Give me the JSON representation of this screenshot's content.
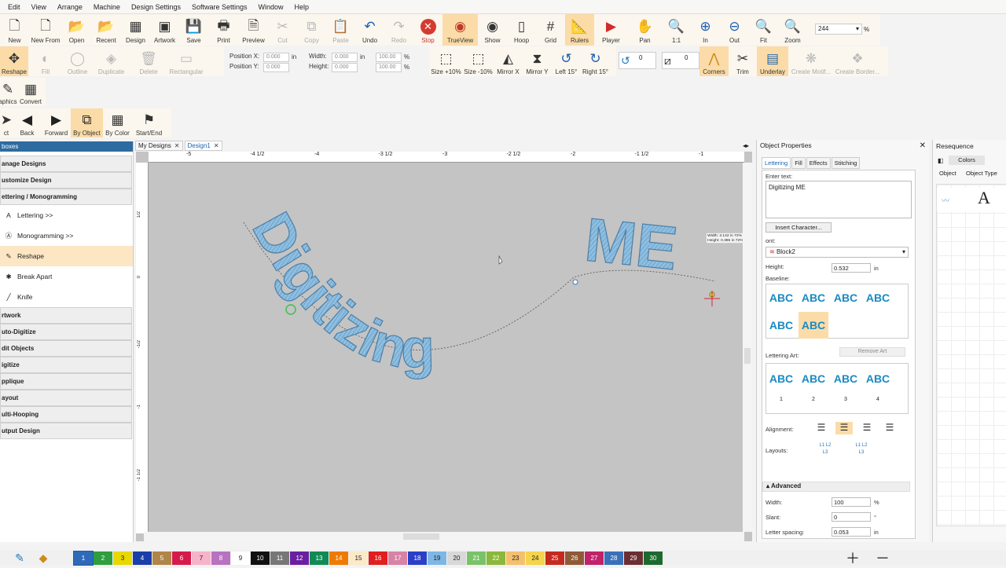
{
  "menu": [
    "Edit",
    "View",
    "Arrange",
    "Machine",
    "Design Settings",
    "Software Settings",
    "Window",
    "Help"
  ],
  "toolbar1": [
    {
      "label": "New",
      "icon": "new-file-icon",
      "state": "normal"
    },
    {
      "label": "New From",
      "icon": "new-from-icon",
      "state": "normal"
    },
    {
      "label": "Open",
      "icon": "open-folder-icon",
      "state": "normal"
    },
    {
      "label": "Recent",
      "icon": "recent-folder-icon",
      "state": "normal"
    },
    {
      "label": "Design",
      "icon": "design-icon",
      "state": "normal"
    },
    {
      "label": "Artwork",
      "icon": "artwork-icon",
      "state": "normal"
    },
    {
      "label": "Save",
      "icon": "save-icon",
      "state": "normal"
    },
    {
      "label": "Print",
      "icon": "print-icon",
      "state": "normal"
    },
    {
      "label": "Preview",
      "icon": "preview-icon",
      "state": "normal"
    },
    {
      "label": "Cut",
      "icon": "cut-icon",
      "state": "disabled"
    },
    {
      "label": "Copy",
      "icon": "copy-icon",
      "state": "disabled"
    },
    {
      "label": "Paste",
      "icon": "paste-icon",
      "state": "disabled"
    },
    {
      "label": "Undo",
      "icon": "undo-icon",
      "state": "normal"
    },
    {
      "label": "Redo",
      "icon": "redo-icon",
      "state": "disabled"
    },
    {
      "label": "Stop",
      "icon": "stop-icon",
      "state": "stop"
    },
    {
      "label": "TrueView",
      "icon": "trueview-eye-icon",
      "state": "selected"
    },
    {
      "label": "Show",
      "icon": "show-eye-icon",
      "state": "normal"
    },
    {
      "label": "Hoop",
      "icon": "hoop-icon",
      "state": "normal"
    },
    {
      "label": "Grid",
      "icon": "grid-icon",
      "state": "normal"
    },
    {
      "label": "Rulers",
      "icon": "rulers-icon",
      "state": "selected"
    },
    {
      "label": "Player",
      "icon": "player-icon",
      "state": "normal"
    },
    {
      "label": "Pan",
      "icon": "pan-hand-icon",
      "state": "normal"
    },
    {
      "label": "1:1",
      "icon": "zoom-1to1-icon",
      "state": "normal"
    },
    {
      "label": "In",
      "icon": "zoom-in-icon",
      "state": "normal"
    },
    {
      "label": "Out",
      "icon": "zoom-out-icon",
      "state": "normal"
    },
    {
      "label": "Fit",
      "icon": "zoom-fit-icon",
      "state": "normal"
    },
    {
      "label": "Zoom",
      "icon": "zoom-icon",
      "state": "normal"
    }
  ],
  "zoom": {
    "value": "244",
    "unit": "%"
  },
  "toolbar2": [
    {
      "label": "Reshape",
      "icon": "reshape-icon",
      "state": "selected"
    },
    {
      "label": "Fill",
      "icon": "fill-icon",
      "state": "disabled"
    },
    {
      "label": "Outline",
      "icon": "outline-icon",
      "state": "disabled"
    },
    {
      "label": "Duplicate",
      "icon": "duplicate-icon",
      "state": "disabled"
    },
    {
      "label": "Delete",
      "icon": "delete-icon",
      "state": "disabled"
    },
    {
      "label": "Rectangular",
      "icon": "rectangular-icon",
      "state": "disabled"
    }
  ],
  "position": {
    "x_label": "Position X:",
    "y_label": "Position Y:",
    "x": "0.000",
    "y": "0.000",
    "unit": "in"
  },
  "size": {
    "w_label": "Width:",
    "h_label": "Height:",
    "w": "0.000",
    "h": "0.000",
    "unit": "in",
    "w_pct": "100.00",
    "h_pct": "100.00",
    "pct": "%"
  },
  "toolbar2b": [
    {
      "label": "Size +10%",
      "icon": "size-up-icon"
    },
    {
      "label": "Size -10%",
      "icon": "size-down-icon"
    },
    {
      "label": "Mirror X",
      "icon": "mirror-x-icon"
    },
    {
      "label": "Mirror Y",
      "icon": "mirror-y-icon"
    },
    {
      "label": "Left 15°",
      "icon": "rotate-left-icon"
    },
    {
      "label": "Right 15°",
      "icon": "rotate-right-icon"
    }
  ],
  "rotate_value": "0",
  "skew_value": "0",
  "toolbar2c": [
    {
      "label": "Corners",
      "icon": "corners-icon",
      "state": "selected"
    },
    {
      "label": "Trim",
      "icon": "trim-icon",
      "state": "normal"
    },
    {
      "label": "Underlay",
      "icon": "underlay-icon",
      "state": "selected"
    },
    {
      "label": "Create Motif...",
      "icon": "motif-icon",
      "state": "disabled"
    },
    {
      "label": "Create Border...",
      "icon": "border-icon",
      "state": "disabled"
    }
  ],
  "toolbar3": [
    {
      "label": "aphics",
      "icon": "graphics-icon"
    },
    {
      "label": "Convert",
      "icon": "convert-icon"
    }
  ],
  "toolbar4": [
    {
      "label": "ct",
      "icon": "select-icon",
      "state": "normal"
    },
    {
      "label": "Back",
      "icon": "back-arrow-icon",
      "state": "normal"
    },
    {
      "label": "Forward",
      "icon": "forward-arrow-icon",
      "state": "normal"
    },
    {
      "label": "By Object",
      "icon": "by-object-icon",
      "state": "selected"
    },
    {
      "label": "By Color",
      "icon": "by-color-icon",
      "state": "normal"
    },
    {
      "label": "Start/End",
      "icon": "start-end-icon",
      "state": "normal"
    }
  ],
  "left_panel": {
    "title": "boxes",
    "items": [
      {
        "type": "section",
        "label": "anage Designs"
      },
      {
        "type": "section",
        "label": "ustomize Design"
      },
      {
        "type": "section",
        "label": "ettering / Monogramming"
      },
      {
        "type": "sub",
        "label": "Lettering >>",
        "icon": "lettering-icon"
      },
      {
        "type": "sub",
        "label": "Monogramming >>",
        "icon": "monogram-icon"
      },
      {
        "type": "sub",
        "label": "Reshape",
        "icon": "reshape-tool-icon",
        "selected": true
      },
      {
        "type": "sub",
        "label": "Break Apart",
        "icon": "break-apart-icon"
      },
      {
        "type": "sub",
        "label": "Knife",
        "icon": "knife-icon"
      },
      {
        "type": "section",
        "label": "rtwork"
      },
      {
        "type": "section",
        "label": "uto-Digitize"
      },
      {
        "type": "section",
        "label": "dit Objects"
      },
      {
        "type": "section",
        "label": "igitize"
      },
      {
        "type": "section",
        "label": "pplique"
      },
      {
        "type": "section",
        "label": "ayout"
      },
      {
        "type": "section",
        "label": "ulti-Hooping"
      },
      {
        "type": "section",
        "label": "utput Design"
      }
    ]
  },
  "doc_tabs": [
    {
      "label": "My Designs",
      "active": false
    },
    {
      "label": "Design1",
      "active": true
    }
  ],
  "ruler_h_labels": [
    "-5",
    "-4 1/2",
    "-4",
    "-3 1/2",
    "-3",
    "-2 1/2",
    "-2",
    "-1 1/2",
    "-1"
  ],
  "ruler_v_labels": [
    "1/2",
    "0",
    "-1/2",
    "-1",
    "-1 1/2"
  ],
  "design_text": {
    "arc": "Digitizing",
    "flat": "ME"
  },
  "tooltip": {
    "line1": "Width: 3.142 in 72%",
    "line2": "Height: 0.385 in 72%"
  },
  "object_properties": {
    "title": "Object Properties",
    "tabs": [
      "Lettering",
      "Fill",
      "Effects",
      "Stitching"
    ],
    "enter_text_label": "Enter text:",
    "text_value": "Digitizing ME",
    "insert_char": "Insert Character...",
    "font_label": "ont:",
    "font_value": "Block2",
    "height_label": "Height:",
    "height_value": "0.532",
    "height_unit": "in",
    "baseline_label": "Baseline:",
    "baseline_samples": [
      "ABC",
      "ABC",
      "ABC",
      "ABC",
      "ABC",
      "ABC"
    ],
    "remove_art": "Remove Art",
    "lettering_art_label": "Lettering Art:",
    "art_samples": [
      "ABC",
      "ABC",
      "ABC",
      "ABC"
    ],
    "art_numbers": [
      "1",
      "2",
      "3",
      "4"
    ],
    "alignment_label": "Alignment:",
    "layouts_label": "Layouts:",
    "layout_samples": [
      "L1 L2 L3",
      "L1 L2 L3"
    ],
    "advanced_label": "Advanced",
    "width_label": "Width:",
    "width_value": "100",
    "width_unit": "%",
    "slant_label": "Slant:",
    "slant_value": "0",
    "slant_unit": "°",
    "spacing_label": "Letter spacing:",
    "spacing_value": "0.053",
    "spacing_unit": "in"
  },
  "resequence": {
    "title": "Resequence",
    "colors_btn": "Colors",
    "col_object": "Object",
    "col_type": "Object Type",
    "type_glyph": "A"
  },
  "palette": [
    {
      "n": "1",
      "c": "#2f6ab8"
    },
    {
      "n": "2",
      "c": "#2e9e3e"
    },
    {
      "n": "3",
      "c": "#e7d800"
    },
    {
      "n": "4",
      "c": "#1a3fa8"
    },
    {
      "n": "5",
      "c": "#b0854a"
    },
    {
      "n": "6",
      "c": "#d61b4a"
    },
    {
      "n": "7",
      "c": "#f6b3c9"
    },
    {
      "n": "8",
      "c": "#b772c0"
    },
    {
      "n": "9",
      "c": "#ffffff"
    },
    {
      "n": "10",
      "c": "#111111"
    },
    {
      "n": "11",
      "c": "#777777"
    },
    {
      "n": "12",
      "c": "#6a1fa0"
    },
    {
      "n": "13",
      "c": "#118a55"
    },
    {
      "n": "14",
      "c": "#ef7a00"
    },
    {
      "n": "15",
      "c": "#fbe9c8"
    },
    {
      "n": "16",
      "c": "#e01f1f"
    },
    {
      "n": "17",
      "c": "#d783a6"
    },
    {
      "n": "18",
      "c": "#2a3fc6"
    },
    {
      "n": "19",
      "c": "#7eb6e6"
    },
    {
      "n": "20",
      "c": "#d8d8d8"
    },
    {
      "n": "21",
      "c": "#7ac26a"
    },
    {
      "n": "22",
      "c": "#8bb83a"
    },
    {
      "n": "23",
      "c": "#f5c06e"
    },
    {
      "n": "24",
      "c": "#f4d44a"
    },
    {
      "n": "25",
      "c": "#c42a1f"
    },
    {
      "n": "26",
      "c": "#8f5a36"
    },
    {
      "n": "27",
      "c": "#c0236a"
    },
    {
      "n": "28",
      "c": "#3a70b8"
    },
    {
      "n": "29",
      "c": "#6b2f33"
    },
    {
      "n": "30",
      "c": "#1d6a2f"
    }
  ],
  "colors": {
    "accent": "#fbdca8",
    "panel_title": "#2d6ba0",
    "canvas": "#c4c4c4",
    "stitch": "#8fbfe0"
  }
}
